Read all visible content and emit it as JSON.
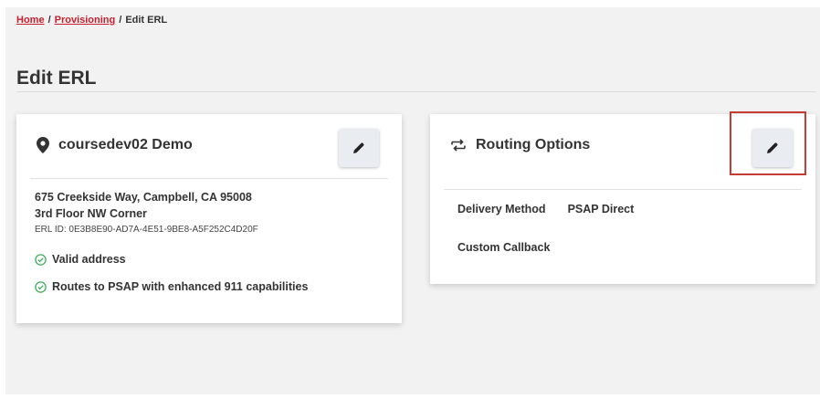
{
  "breadcrumb": {
    "home": "Home",
    "provisioning": "Provisioning",
    "current": "Edit ERL",
    "separator": "/"
  },
  "page": {
    "title": "Edit ERL"
  },
  "location_card": {
    "title": "coursedev02 Demo",
    "address_line1": "675 Creekside Way, Campbell, CA 95008",
    "address_line2": "3rd Floor NW Corner",
    "erl_id": "ERL ID: 0E3B8E90-AD7A-4E51-9BE8-A5F252C4D20F",
    "status_valid": "Valid address",
    "status_routes": "Routes to PSAP with enhanced 911 capabilities"
  },
  "routing_card": {
    "title": "Routing Options",
    "delivery_method_label": "Delivery Method",
    "delivery_method_value": "PSAP Direct",
    "custom_callback_label": "Custom Callback"
  },
  "colors": {
    "accent_red": "#c8202f",
    "check_green": "#3fae5a",
    "highlight_box": "#c63b32"
  },
  "icons": {
    "location": "map-pin-icon",
    "routing": "routing-arrows-icon",
    "edit": "pencil-icon",
    "status": "check-circle-icon"
  }
}
